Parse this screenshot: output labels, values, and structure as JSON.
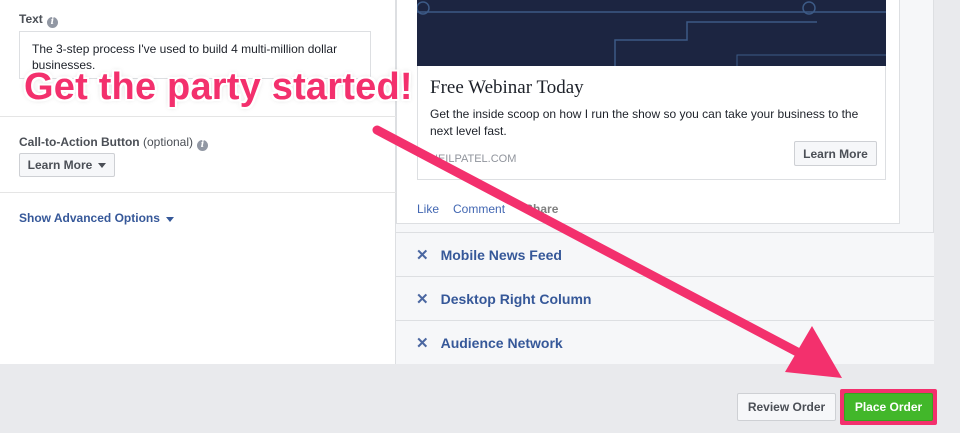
{
  "left": {
    "text_label": "Text",
    "text_value": "The 3-step process I've used to build 4 multi-million dollar businesses.",
    "cta_label": "Call-to-Action Button",
    "cta_optional": "(optional)",
    "cta_button": "Learn More",
    "advanced_link": "Show Advanced Options"
  },
  "overlay": {
    "caption": "Get the party started!",
    "accent_color": "#f3306d"
  },
  "preview": {
    "title": "Free Webinar Today",
    "description": "Get the inside scoop on how I run the show so you can take your business to the next level fast.",
    "domain": "NEILPATEL.COM",
    "cta_button": "Learn More",
    "actions": {
      "like": "Like",
      "comment": "Comment",
      "share": "Share"
    }
  },
  "placements": [
    {
      "icon": "close-icon",
      "label": "Mobile News Feed"
    },
    {
      "icon": "close-icon",
      "label": "Desktop Right Column"
    },
    {
      "icon": "close-icon",
      "label": "Audience Network"
    }
  ],
  "footer": {
    "review_button": "Review Order",
    "place_button": "Place Order",
    "place_color": "#42b72a"
  }
}
